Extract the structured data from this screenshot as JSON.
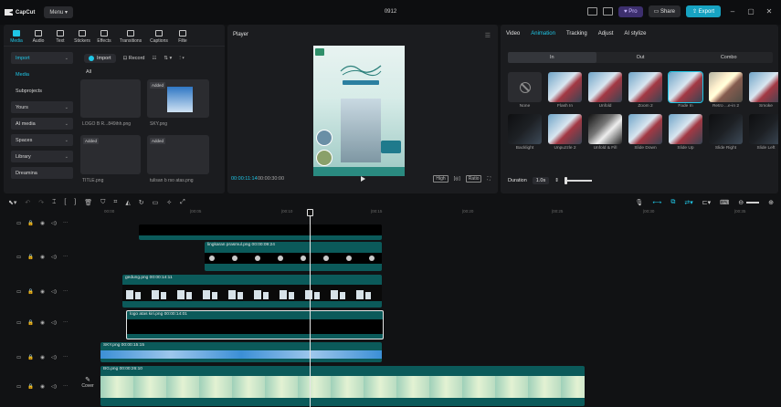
{
  "app": {
    "name": "CapCut",
    "menu_label": "Menu",
    "project_title": "0912"
  },
  "titlebar": {
    "pro_label": "Pro",
    "share_label": "Share",
    "export_label": "Export"
  },
  "tools": [
    {
      "label": "Media",
      "icon": "media-icon",
      "active": true
    },
    {
      "label": "Audio",
      "icon": "audio-icon",
      "active": false
    },
    {
      "label": "Text",
      "icon": "text-icon",
      "active": false
    },
    {
      "label": "Stickers",
      "icon": "stickers-icon",
      "active": false
    },
    {
      "label": "Effects",
      "icon": "effects-icon",
      "active": false
    },
    {
      "label": "Transitions",
      "icon": "transitions-icon",
      "active": false
    },
    {
      "label": "Captions",
      "icon": "captions-icon",
      "active": false
    },
    {
      "label": "Filte",
      "icon": "filters-icon",
      "active": false
    }
  ],
  "sidebar": {
    "items": [
      {
        "label": "Import",
        "chevron": true
      },
      {
        "label": "Media",
        "chevron": false
      },
      {
        "label": "Subprojects",
        "chevron": false
      },
      {
        "label": "Yours",
        "chevron": true
      },
      {
        "label": "AI media",
        "chevron": true
      },
      {
        "label": "Spaces",
        "chevron": true
      },
      {
        "label": "Library",
        "chevron": true
      },
      {
        "label": "Dreamina",
        "chevron": false
      }
    ]
  },
  "media": {
    "import_label": "Import",
    "record_label": "Record",
    "all_label": "All",
    "items": [
      {
        "name": "LOGO B R...849ihh.png",
        "added": false
      },
      {
        "name": "SKY.png",
        "added": true
      },
      {
        "name": "TITLE.png",
        "added": true
      },
      {
        "name": "tulisan b rso atas.png",
        "added": true
      }
    ],
    "added_label": "Added"
  },
  "player": {
    "title": "Player",
    "current_time": "00:00:11:14",
    "total_time": "00:00:30:00",
    "quality_label": "High",
    "ratio_label": "Ratio"
  },
  "right_panel": {
    "tabs": [
      "Video",
      "Animation",
      "Tracking",
      "Adjust",
      "AI stylize"
    ],
    "active_tab": "Animation",
    "segments": [
      "In",
      "Out",
      "Combo"
    ],
    "active_segment": "In",
    "animations": [
      "None",
      "Flash In",
      "Unfold",
      "Zoom 2",
      "Fade In",
      "Retro ...e-in 2",
      "Smoke",
      "Backlight",
      "Unpuzzle 2",
      "Unfold & Fill",
      "Slide Down",
      "Slide Up",
      "Slide Right",
      "Slide Left"
    ],
    "duration_label": "Duration",
    "duration_value": "1.0s"
  },
  "timeline": {
    "ticks": [
      "00:00",
      "|00:05",
      "|00:10",
      "|00:15",
      "|00:20",
      "|00:25",
      "|00:30",
      "|00:35"
    ],
    "tracks": [
      {
        "clip_label": "lingkaran prasmul.png  00:00:09:24"
      },
      {
        "clip_label": "gedung.png  00:00:14:11"
      },
      {
        "clip_label": "logo atas kiri.png  00:00:14:01"
      },
      {
        "clip_label": "SKY.png  00:00:15:15"
      },
      {
        "clip_label": "BG.png  00:00:26:10"
      }
    ],
    "cover_label": "Cover"
  },
  "colors": {
    "accent": "#1fc6e6",
    "clip_teal": "#0b5a5a",
    "pro": "#3d2f6e",
    "export": "#17a3c2"
  }
}
